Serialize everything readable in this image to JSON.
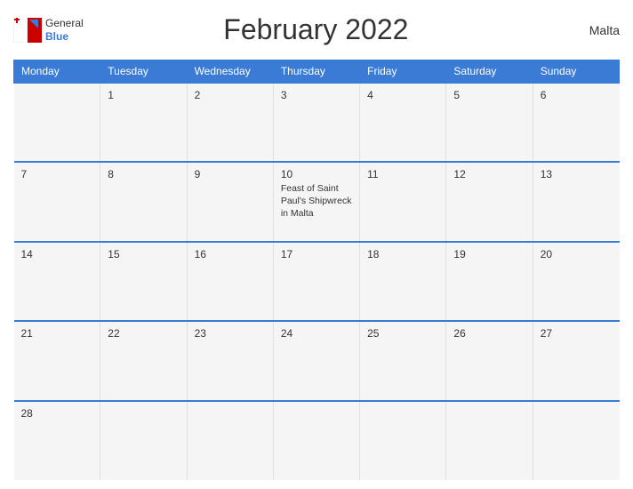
{
  "header": {
    "title": "February 2022",
    "country": "Malta",
    "logo": {
      "general": "General",
      "blue": "Blue"
    }
  },
  "calendar": {
    "days_of_week": [
      "Monday",
      "Tuesday",
      "Wednesday",
      "Thursday",
      "Friday",
      "Saturday",
      "Sunday"
    ],
    "weeks": [
      [
        {
          "day": null,
          "events": []
        },
        {
          "day": 1,
          "events": []
        },
        {
          "day": 2,
          "events": []
        },
        {
          "day": 3,
          "events": []
        },
        {
          "day": 4,
          "events": []
        },
        {
          "day": 5,
          "events": []
        },
        {
          "day": 6,
          "events": []
        }
      ],
      [
        {
          "day": 7,
          "events": []
        },
        {
          "day": 8,
          "events": []
        },
        {
          "day": 9,
          "events": []
        },
        {
          "day": 10,
          "events": [
            "Feast of Saint Paul's Shipwreck in Malta"
          ]
        },
        {
          "day": 11,
          "events": []
        },
        {
          "day": 12,
          "events": []
        },
        {
          "day": 13,
          "events": []
        }
      ],
      [
        {
          "day": 14,
          "events": []
        },
        {
          "day": 15,
          "events": []
        },
        {
          "day": 16,
          "events": []
        },
        {
          "day": 17,
          "events": []
        },
        {
          "day": 18,
          "events": []
        },
        {
          "day": 19,
          "events": []
        },
        {
          "day": 20,
          "events": []
        }
      ],
      [
        {
          "day": 21,
          "events": []
        },
        {
          "day": 22,
          "events": []
        },
        {
          "day": 23,
          "events": []
        },
        {
          "day": 24,
          "events": []
        },
        {
          "day": 25,
          "events": []
        },
        {
          "day": 26,
          "events": []
        },
        {
          "day": 27,
          "events": []
        }
      ],
      [
        {
          "day": 28,
          "events": []
        },
        {
          "day": null,
          "events": []
        },
        {
          "day": null,
          "events": []
        },
        {
          "day": null,
          "events": []
        },
        {
          "day": null,
          "events": []
        },
        {
          "day": null,
          "events": []
        },
        {
          "day": null,
          "events": []
        }
      ]
    ]
  }
}
